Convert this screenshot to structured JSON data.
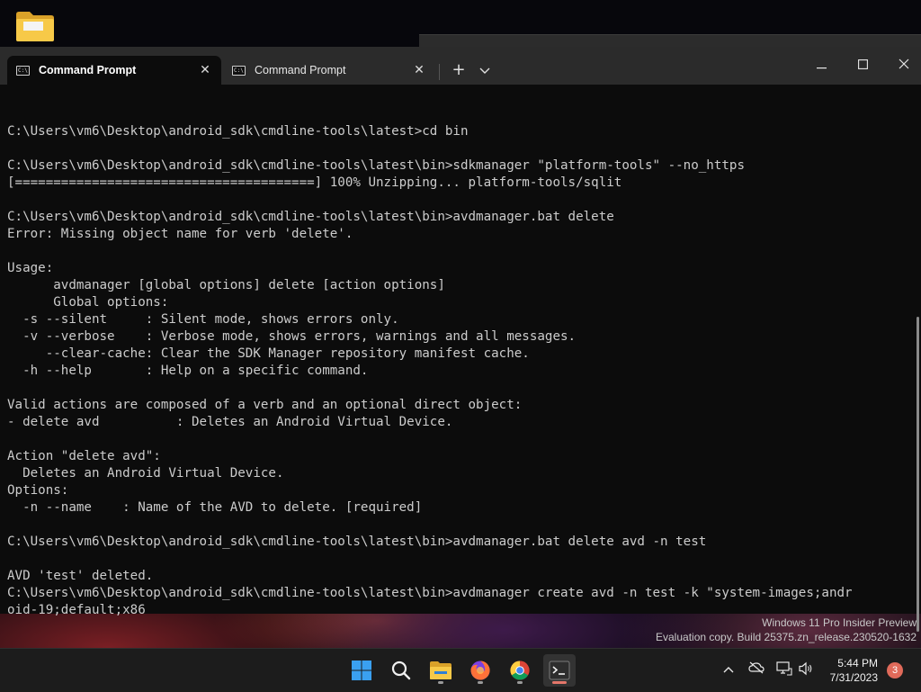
{
  "window": {
    "tabs": [
      {
        "title": "Command Prompt",
        "active": true,
        "icon": "cmd-icon"
      },
      {
        "title": "Command Prompt",
        "active": false,
        "icon": "cmd-icon"
      }
    ],
    "new_tab": "+",
    "dropdown": "⌄",
    "minimize": "—",
    "maximize": "☐",
    "close": "✕"
  },
  "console": {
    "lines": [
      "",
      "C:\\Users\\vm6\\Desktop\\android_sdk\\cmdline-tools\\latest>cd bin",
      "",
      "C:\\Users\\vm6\\Desktop\\android_sdk\\cmdline-tools\\latest\\bin>sdkmanager \"platform-tools\" --no_https",
      "[=======================================] 100% Unzipping... platform-tools/sqlit",
      "",
      "C:\\Users\\vm6\\Desktop\\android_sdk\\cmdline-tools\\latest\\bin>avdmanager.bat delete",
      "Error: Missing object name for verb 'delete'.",
      "",
      "Usage:",
      "      avdmanager [global options] delete [action options]",
      "      Global options:",
      "  -s --silent     : Silent mode, shows errors only.",
      "  -v --verbose    : Verbose mode, shows errors, warnings and all messages.",
      "     --clear-cache: Clear the SDK Manager repository manifest cache.",
      "  -h --help       : Help on a specific command.",
      "",
      "Valid actions are composed of a verb and an optional direct object:",
      "- delete avd          : Deletes an Android Virtual Device.",
      "",
      "Action \"delete avd\":",
      "  Deletes an Android Virtual Device.",
      "Options:",
      "  -n --name    : Name of the AVD to delete. [required]",
      "",
      "C:\\Users\\vm6\\Desktop\\android_sdk\\cmdline-tools\\latest\\bin>avdmanager.bat delete avd -n test",
      "",
      "AVD 'test' deleted.",
      "C:\\Users\\vm6\\Desktop\\android_sdk\\cmdline-tools\\latest\\bin>avdmanager create avd -n test -k \"system-images;andr",
      "oid-19;default;x86"
    ]
  },
  "watermark": {
    "line1": "Windows 11 Pro Insider Preview",
    "line2": "Evaluation copy. Build 25375.zn_release.230520-1632"
  },
  "taskbar": {
    "apps": [
      {
        "name": "start-icon"
      },
      {
        "name": "search-icon"
      },
      {
        "name": "file-explorer-icon"
      },
      {
        "name": "firefox-icon"
      },
      {
        "name": "chrome-icon"
      },
      {
        "name": "terminal-icon"
      }
    ],
    "clock_time": "5:44 PM",
    "clock_date": "7/31/2023",
    "notification_count": "3"
  },
  "colors": {
    "console_bg": "#0c0c0c",
    "console_text": "#cccccc",
    "titlebar": "#2b2b2b",
    "taskbar": "#1c1c1c",
    "notification": "#e06a5a"
  }
}
